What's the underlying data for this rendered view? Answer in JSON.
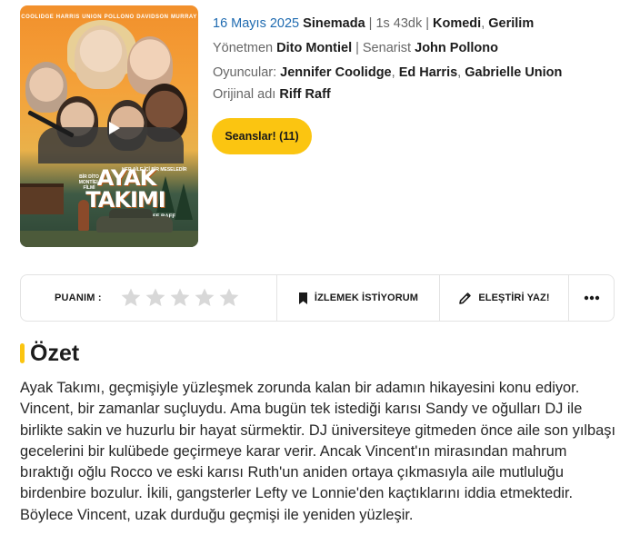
{
  "movie": {
    "release_date": "16 Mayıs 2025",
    "status": "Sinemada",
    "duration": "1s 43dk",
    "genres": [
      "Komedi",
      "Gerilim"
    ],
    "director_label": "Yönetmen",
    "director": "Dito Montiel",
    "writer_label": "Senarist",
    "writer": "John Pollono",
    "cast_label": "Oyuncular:",
    "cast": [
      "Jennifer Coolidge",
      "Ed Harris",
      "Gabrielle Union"
    ],
    "original_title_label": "Orijinal adı",
    "original_title": "Riff Raff"
  },
  "poster": {
    "credits_top": [
      "COOLIDGE",
      "HARRIS",
      "UNION",
      "POLLONO",
      "DAVIDSON",
      "MURRAY"
    ],
    "tagline": "HER AİLE İÇİ BİR MESELEDİR",
    "director_credit": "BİR DİTO MONTİEL FİLMİ",
    "title_line1": "AYAK",
    "title_line2": "TAKIMI",
    "subtitle": "RIFF RAFF",
    "play_icon": "play-icon"
  },
  "showtimes_button": "Seanslar! (11)",
  "action_bar": {
    "rating_label": "PUANIM :",
    "star_count": 5,
    "rating_value": 0,
    "star_color_empty": "#d8d8d8",
    "watchlist_label": "İZLEMEK İSTİYORUM",
    "review_label": "ELEŞTİRİ YAZ!",
    "more_icon": "ellipsis-icon"
  },
  "summary": {
    "heading": "Özet",
    "text": "Ayak Takımı, geçmişiyle yüzleşmek zorunda kalan bir adamın hikayesini konu ediyor. Vincent, bir zamanlar suçluydu. Ama bugün tek istediği karısı Sandy ve oğulları DJ ile birlikte sakin ve huzurlu bir hayat sürmektir. DJ üniversiteye gitmeden önce aile son yılbaşı gecelerini bir kulübede geçirmeye karar verir. Ancak Vincent'ın mirasından mahrum bıraktığı oğlu Rocco ve eski karısı Ruth'un aniden ortaya çıkmasıyla aile mutluluğu birdenbire bozulur. İkili, gangsterler Lefty  ve Lonnie'den kaçtıklarını iddia etmektedir. Böylece Vincent, uzak durduğu geçmişi ile yeniden yüzleşir."
  },
  "colors": {
    "accent": "#fbc511",
    "date_blue": "#1e6ab0"
  }
}
